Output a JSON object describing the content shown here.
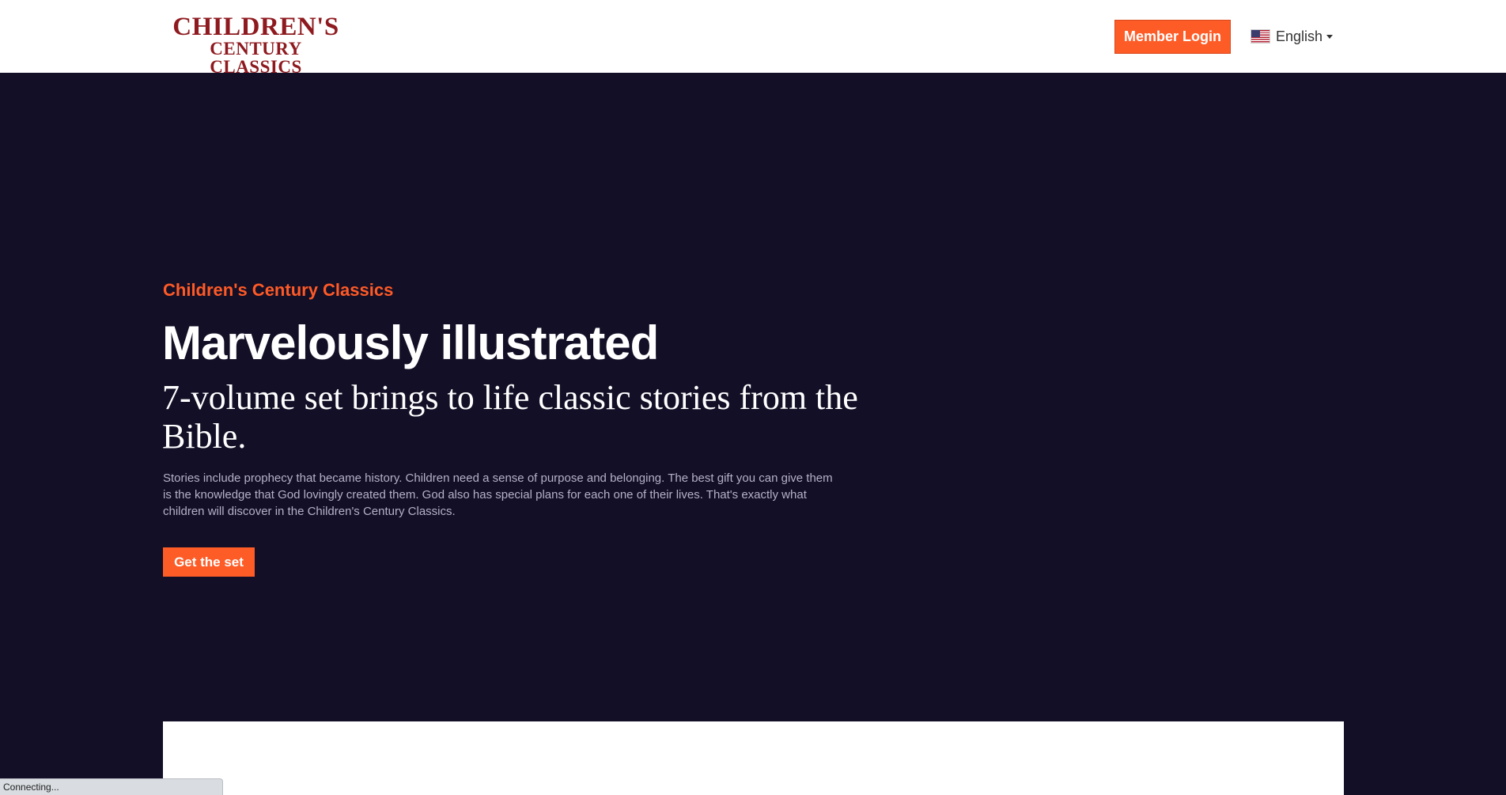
{
  "header": {
    "logo_line1": "CHILDREN'S",
    "logo_line2": "CENTURY CLASSICS",
    "login_label": "Member Login",
    "language": "English",
    "language_flag": "us-flag-icon"
  },
  "hero": {
    "eyebrow": "Children's Century Classics",
    "title": "Marvelously illustrated",
    "subtitle": "7-volume set brings to life classic stories from the Bible.",
    "body": "Stories include prophecy that became history. Children need a sense of purpose and belonging. The best gift you can give them is the knowledge that God lovingly created them. God also has special plans for each one of their lives. That's exactly what children will discover in the Children's Century Classics.",
    "cta_label": "Get the set"
  },
  "status_bar": {
    "text": "Connecting..."
  },
  "colors": {
    "accent": "#fe5c27",
    "hero_background": "#130f26",
    "logo": "#8e1a1f"
  }
}
